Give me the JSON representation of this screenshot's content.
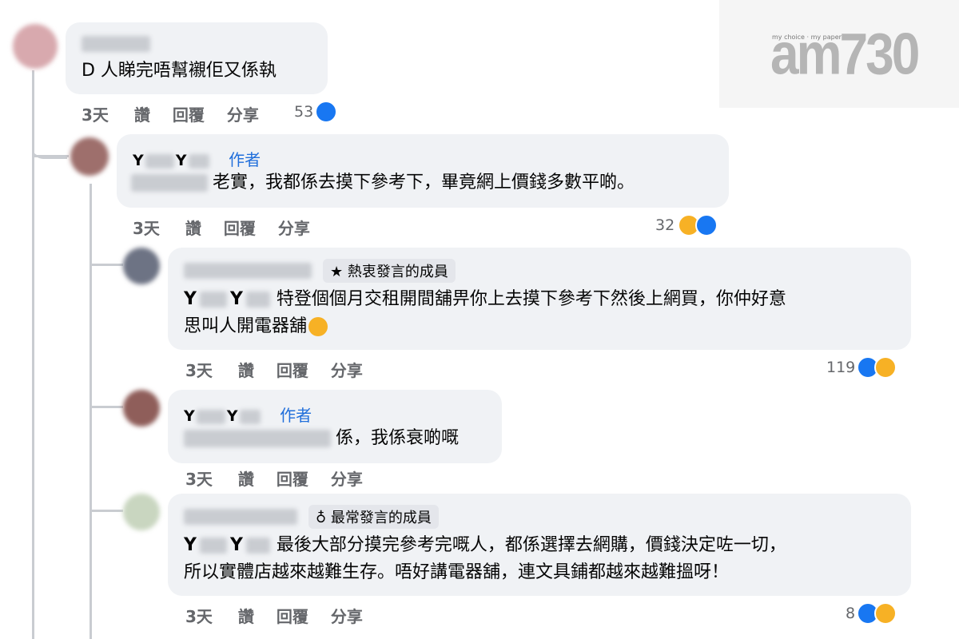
{
  "watermark": {
    "tagline": "my choice · my paper",
    "brand": "am730"
  },
  "comments": [
    {
      "text": "D 人睇完唔幫襯佢又係執",
      "time": "3天",
      "like": "讚",
      "reply": "回覆",
      "share": "分享",
      "reaction_count": "53"
    },
    {
      "name_prefix": "Y",
      "name_mid": "Y",
      "author_tag": "作者",
      "text": "老實，我都係去摸下參考下，畢竟網上價錢多數平啲。",
      "time": "3天",
      "like": "讚",
      "reply": "回覆",
      "share": "分享",
      "reaction_count": "32"
    },
    {
      "badge": "熱衷發言的成員",
      "name_prefix": "Y",
      "name_mid": "Y",
      "text_line1": "特登個個月交租開間舖畀你上去摸下參考下然後上網買，你仲好意",
      "text_line2": "思叫人開電器舖",
      "time": "3天",
      "like": "讚",
      "reply": "回覆",
      "share": "分享",
      "reaction_count": "119"
    },
    {
      "name_prefix": "Y",
      "name_mid": "Y",
      "author_tag": "作者",
      "text": "係，我係衰啲嘅",
      "time": "3天",
      "like": "讚",
      "reply": "回覆",
      "share": "分享"
    },
    {
      "badge": "最常發言的成員",
      "name_prefix": "Y",
      "name_mid": "Y",
      "text_line1": "最後大部分摸完參考完嘅人，都係選擇去網購，價錢決定咗一切，",
      "text_line2": "所以實體店越來越難生存。唔好講電器舖，連文具鋪都越來越難搵呀！",
      "time": "3天",
      "like": "讚",
      "reply": "回覆",
      "share": "分享",
      "reaction_count": "8"
    }
  ],
  "icons": {
    "like": "like-icon",
    "haha": "haha-emoji-icon",
    "sad": "sad-emoji-icon",
    "star": "star-icon",
    "medal": "medal-icon"
  },
  "colors": {
    "bubble": "#f0f2f5",
    "author": "#216fdb",
    "like_blue": "#1877f2",
    "meta_gray": "#65676b"
  }
}
